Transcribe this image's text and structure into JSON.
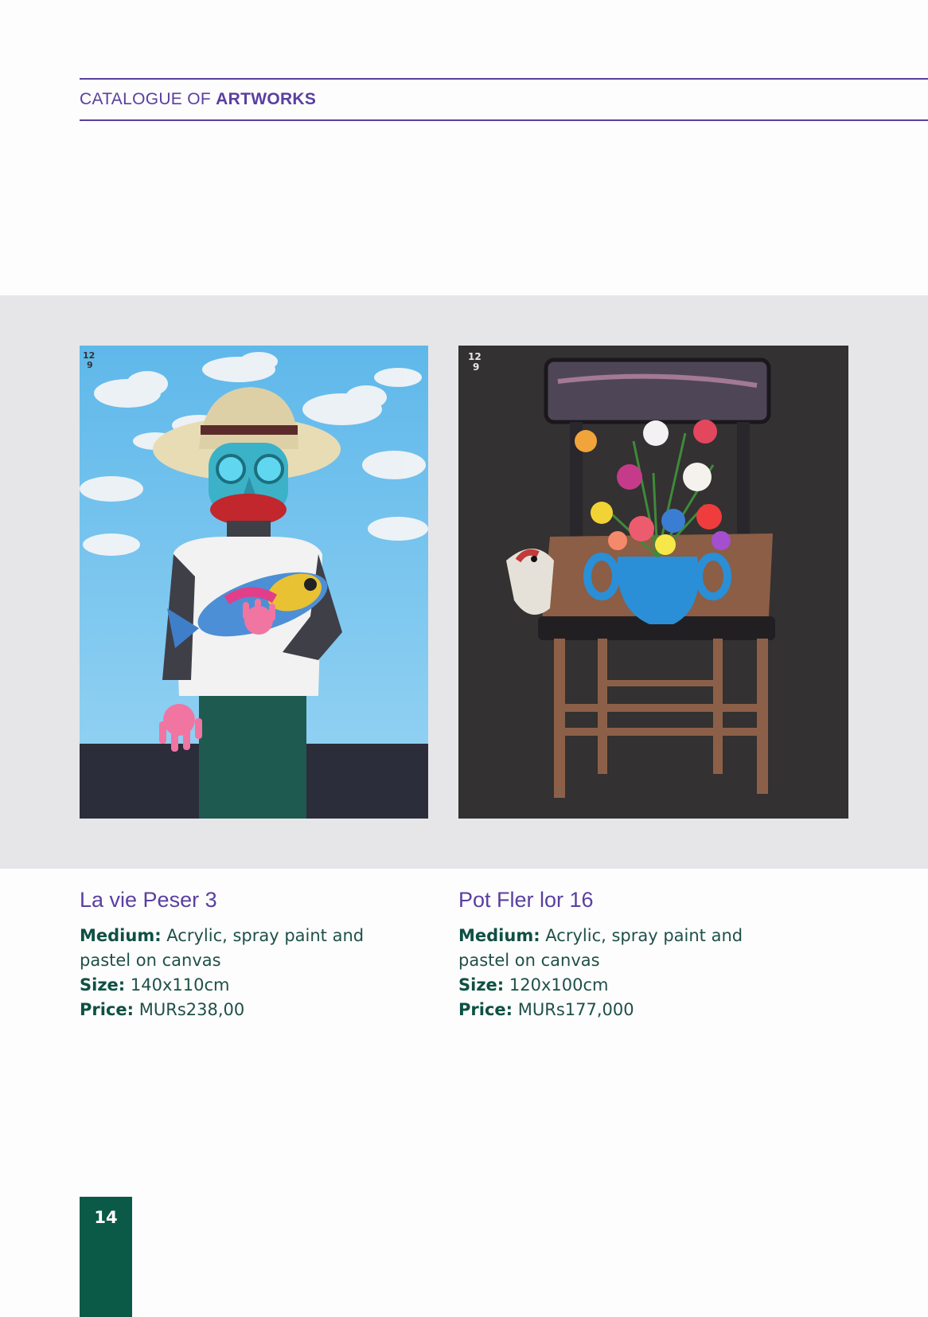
{
  "header": {
    "prefix": "CATALOGUE OF",
    "emphasis": "ARTWORKS"
  },
  "artworks": [
    {
      "title": "La vie Peser 3",
      "medium_label": "Medium:",
      "medium_line1": "Acrylic, spray paint and",
      "medium_line2": "pastel on canvas",
      "size_label": "Size:",
      "size": "140x110cm",
      "price_label": "Price:",
      "price": "MURs238,00",
      "signature": "12\n9"
    },
    {
      "title": "Pot Fler lor 16",
      "medium_label": "Medium:",
      "medium_line1": "Acrylic, spray paint and",
      "medium_line2": "pastel on canvas",
      "size_label": "Size:",
      "size": "120x100cm",
      "price_label": "Price:",
      "price": "MURs177,000",
      "signature": "12\n9"
    }
  ],
  "page_number": "14",
  "colors": {
    "accent_purple": "#5a3fa0",
    "accent_green": "#0b5a47",
    "band_gray": "#e6e6e8"
  }
}
